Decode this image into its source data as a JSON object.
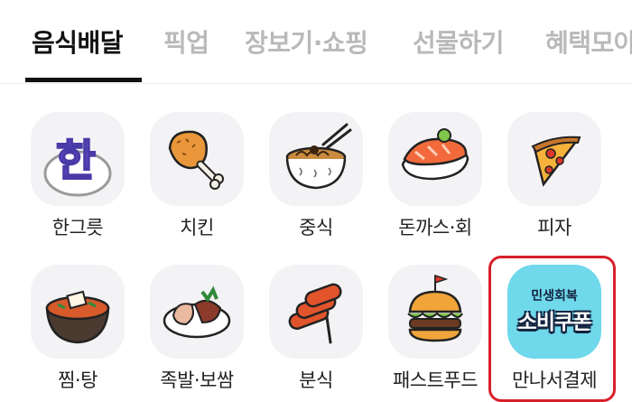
{
  "tabs": [
    {
      "label": "음식배달",
      "active": true
    },
    {
      "label": "픽업",
      "active": false
    },
    {
      "label": "장보기·쇼핑",
      "active": false
    },
    {
      "label": "선물하기",
      "active": false
    },
    {
      "label": "혜택모아",
      "active": false
    }
  ],
  "categories": [
    {
      "label": "한그릇",
      "icon": "han-bowl-icon"
    },
    {
      "label": "치킨",
      "icon": "chicken-drumstick-icon"
    },
    {
      "label": "중식",
      "icon": "noodle-bowl-icon"
    },
    {
      "label": "돈까스·회",
      "icon": "sushi-icon"
    },
    {
      "label": "피자",
      "icon": "pizza-slice-icon"
    },
    {
      "label": "찜·탕",
      "icon": "stew-pot-icon"
    },
    {
      "label": "족발·보쌈",
      "icon": "jokbal-plate-icon"
    },
    {
      "label": "분식",
      "icon": "tteokbokki-icon"
    },
    {
      "label": "패스트푸드",
      "icon": "burger-icon"
    },
    {
      "label": "만나서결제",
      "icon": "coupon-banner-icon",
      "badge_small": "민생회복",
      "badge_big": "소비쿠폰"
    }
  ],
  "colors": {
    "active_tab": "#111111",
    "inactive_tab": "#b9b9b9",
    "tile_bg": "#f3f3f5",
    "coupon_bg": "#6fd8ea",
    "highlight": "#d8202a"
  }
}
